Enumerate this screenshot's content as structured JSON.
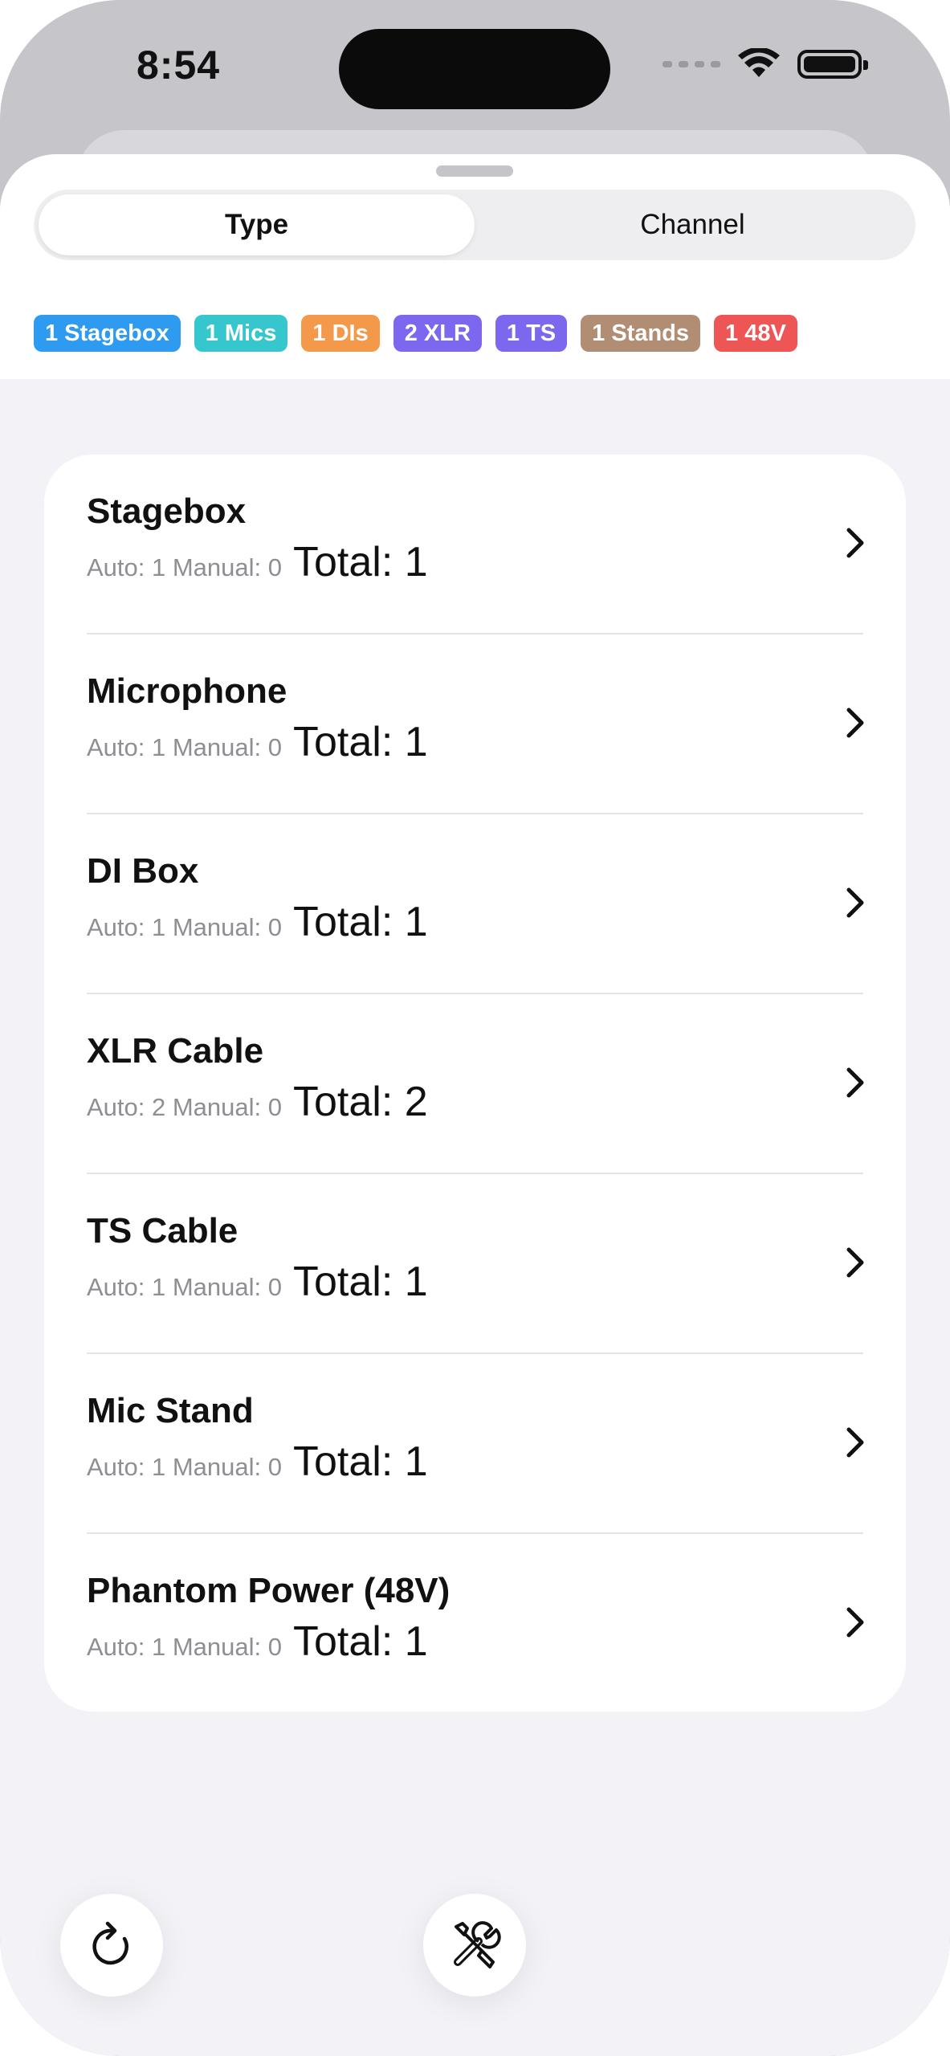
{
  "status_bar": {
    "time": "8:54"
  },
  "segmented": {
    "tabs": [
      {
        "label": "Type",
        "active": true
      },
      {
        "label": "Channel",
        "active": false
      }
    ]
  },
  "chips": [
    {
      "label": "1 Stagebox",
      "color": "#2E9BF0"
    },
    {
      "label": "1 Mics",
      "color": "#35C6CE"
    },
    {
      "label": "1 DIs",
      "color": "#F4994A"
    },
    {
      "label": "2 XLR",
      "color": "#7B68EE"
    },
    {
      "label": "1 TS",
      "color": "#7B68EE"
    },
    {
      "label": "1 Stands",
      "color": "#B18D74"
    },
    {
      "label": "1 48V",
      "color": "#EE5555"
    }
  ],
  "list": {
    "items": [
      {
        "title": "Stagebox",
        "counts": "Auto: 1 Manual: 0",
        "total": "Total: 1"
      },
      {
        "title": "Microphone",
        "counts": "Auto: 1 Manual: 0",
        "total": "Total: 1"
      },
      {
        "title": "DI Box",
        "counts": "Auto: 1 Manual: 0",
        "total": "Total: 1"
      },
      {
        "title": "XLR Cable",
        "counts": "Auto: 2 Manual: 0",
        "total": "Total: 2"
      },
      {
        "title": "TS Cable",
        "counts": "Auto: 1 Manual: 0",
        "total": "Total: 1"
      },
      {
        "title": "Mic Stand",
        "counts": "Auto: 1 Manual: 0",
        "total": "Total: 1"
      },
      {
        "title": "Phantom Power (48V)",
        "counts": "Auto: 1 Manual: 0",
        "total": "Total: 1"
      }
    ]
  },
  "bottom_buttons": [
    {
      "icon": "refresh-icon"
    },
    {
      "icon": "tools-icon"
    }
  ]
}
